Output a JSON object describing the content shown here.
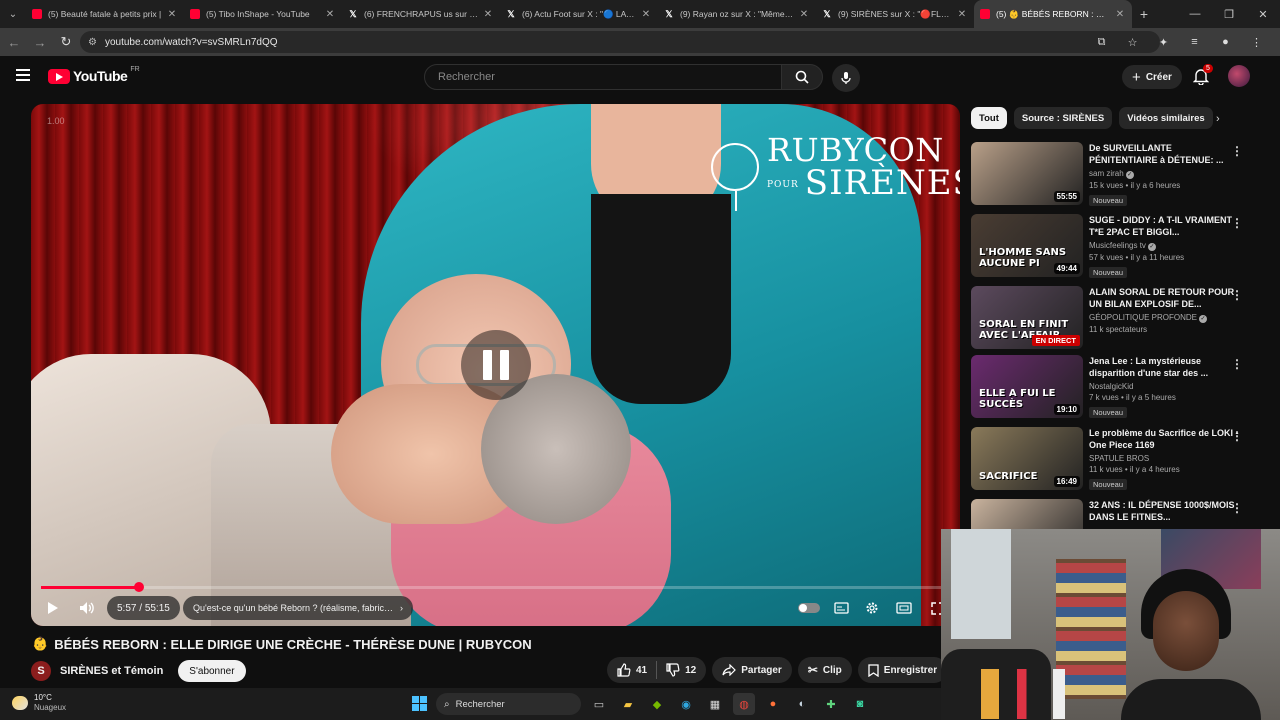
{
  "browser": {
    "tabs": [
      {
        "title": "(5) Beauté fatale à petits prix | ",
        "favicon": "youtube-icon"
      },
      {
        "title": "(5) Tibo InShape - YouTube",
        "favicon": "youtube-icon"
      },
      {
        "title": "(6) FRENCHRAPUS us sur X : \"",
        "favicon": "x-icon"
      },
      {
        "title": "(6) Actu Foot sur X : \"🔵 LA PL",
        "favicon": "x-icon"
      },
      {
        "title": "(9) Rayan oz sur X : \"Même à la",
        "favicon": "x-icon"
      },
      {
        "title": "(9) SIRÈNES sur X : \"🔴FLASH I",
        "favicon": "x-icon"
      },
      {
        "title": "(5) 👶 BÉBÉS REBORN : ELL",
        "favicon": "youtube-icon"
      }
    ],
    "active_tab_index": 6,
    "url": "youtube.com/watch?v=svSMRLn7dQQ"
  },
  "header": {
    "logo_text": "YouTube",
    "country": "FR",
    "search_placeholder": "Rechercher",
    "create_label": "Créer",
    "notifications_count": "5"
  },
  "player": {
    "speed_label": "1.00",
    "watermark_top": "RUBYCON",
    "watermark_pour": "POUR",
    "watermark_bottom": "SIRÈNES",
    "current_time": "5:57",
    "separator": " / ",
    "duration": "55:15",
    "chapter": "Qu'est-ce qu'un bébé Reborn ? (réalisme, fabricat...",
    "progress_fraction": 0.108
  },
  "video": {
    "title_emoji": "👶",
    "title": "BÉBÉS REBORN : ELLE DIRIGE UNE CRÈCHE - THÉRÈSE DUNE | RUBYCON",
    "channel_initial": "S",
    "channel": "SIRÈNES et Témoin",
    "subscribe_label": "S'abonner",
    "likes": "41",
    "dislikes": "12",
    "share_label": "Partager",
    "clip_label": "Clip",
    "save_label": "Enregistrer"
  },
  "sidebar": {
    "chips": [
      "Tout",
      "Source : SIRÈNES",
      "Vidéos similaires"
    ],
    "recommendations": [
      {
        "title": "De SURVEILLANTE PÉNITENTIAIRE à DÉTENUE: ...",
        "channel": "sam zirah",
        "verified": true,
        "meta": "15 k vues • il y a 6 heures",
        "badge": "Nouveau",
        "duration": "55:55",
        "thumb_color": "#b9a089",
        "caption": ""
      },
      {
        "title": "SUGE - DIDDY : A T-IL VRAIMENT T*E 2PAC ET BIGGI...",
        "channel": "Musicfeelings tv",
        "verified": true,
        "meta": "57 k vues • il y a 11 heures",
        "badge": "Nouveau",
        "duration": "49:44",
        "thumb_color": "#4a3d33",
        "caption": "L'HOMME SANS AUCUNE PI"
      },
      {
        "title": "ALAIN SORAL DE RETOUR POUR UN BILAN EXPLOSIF DE...",
        "channel": "GÉOPOLITIQUE PROFONDE",
        "verified": true,
        "meta": "11 k spectateurs",
        "badge": "",
        "duration": "",
        "live": "EN DIRECT",
        "thumb_color": "#5c4a5e",
        "caption": "SORAL EN FINIT AVEC L'AFFAIR"
      },
      {
        "title": "Jena Lee : La mystérieuse disparition d'une star des ...",
        "channel": "NostalgicKid",
        "verified": false,
        "meta": "7 k vues • il y a 5 heures",
        "badge": "Nouveau",
        "duration": "19:10",
        "thumb_color": "#6b2a6f",
        "caption": "ELLE A FUI LE SUCCÈS"
      },
      {
        "title": "Le problème du Sacrifice de LOKI - One Piece 1169",
        "channel": "SPATULE BROS",
        "verified": false,
        "meta": "11 k vues • il y a 4 heures",
        "badge": "Nouveau",
        "duration": "16:49",
        "thumb_color": "#8a7a5a",
        "caption": "SACRIFICE"
      },
      {
        "title": "32 ANS : IL DÉPENSE 1000$/MOIS DANS LE FITNES...",
        "channel": "",
        "verified": false,
        "meta": "",
        "badge": "",
        "duration": "",
        "thumb_color": "#c9b39e",
        "caption": ""
      }
    ]
  },
  "taskbar": {
    "weather_temp": "10°C",
    "weather_desc": "Nuageux",
    "search_label": "Rechercher"
  }
}
